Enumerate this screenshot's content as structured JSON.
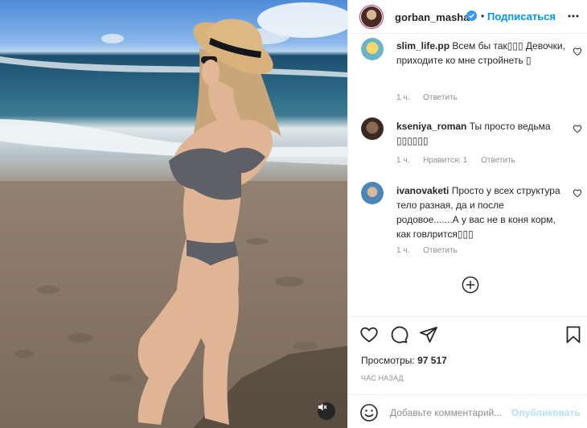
{
  "post": {
    "author": "gorban_masha",
    "follow_label": "Подписаться",
    "separator": "•",
    "views_label": "Просмотры:",
    "views_count": "97 517",
    "posted_time": "час назад"
  },
  "comments": [
    {
      "username": "slim_life.pp",
      "text": "Всем бы так▯▯▯ Девочки, приходите ко мне стройнеть ▯",
      "time": "1 ч.",
      "likes": "",
      "reply_label": "Ответить"
    },
    {
      "username": "kseniya_roman",
      "text": "Ты просто ведьма ▯▯▯▯▯▯",
      "time": "1 ч.",
      "likes": "Нравится: 1",
      "reply_label": "Ответить"
    },
    {
      "username": "ivanovaketi",
      "text": "Просто у всех структура тело разная, да и после родовое.......А у вас не в коня корм, как говлрится▯▯▯",
      "time": "1 ч.",
      "likes": "",
      "reply_label": "Ответить"
    }
  ],
  "add_comment": {
    "placeholder": "Добавьте комментарий...",
    "publish_label": "Опубликовать"
  },
  "icons": {
    "verified": "verified-badge-icon",
    "more": "more-options-icon",
    "like": "heart-icon",
    "comment": "comment-icon",
    "share": "share-icon",
    "save": "bookmark-icon",
    "emoji": "emoji-icon",
    "load_more": "plus-circle-icon",
    "mute": "sound-off-icon"
  },
  "colors": {
    "link_blue": "#0095f6",
    "verified_blue": "#3897f0",
    "muted_text": "#8e8e8e",
    "publish_disabled": "#b2dffc"
  }
}
